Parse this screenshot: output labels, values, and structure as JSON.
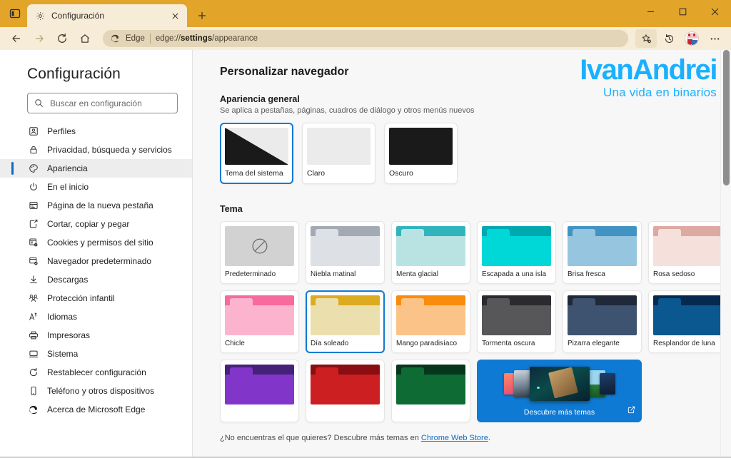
{
  "window": {
    "tab": {
      "title": "Configuración",
      "favicon": "gear-icon",
      "close": "×"
    },
    "new_tab": "+",
    "controls": {
      "minimize": "−",
      "maximize": "□",
      "close": "✕"
    },
    "titlebar_color": "#e2a52a",
    "toolbar_color": "#f7ecd7"
  },
  "toolbar": {
    "back": "←",
    "forward": "→",
    "reload": "⟳",
    "home": "⌂",
    "omnibox": {
      "brand": "Edge",
      "url_prefix": "edge://",
      "url_bold": "settings",
      "url_suffix": "/appearance",
      "full_url": "edge://settings/appearance"
    },
    "favorites": "star-plus-icon",
    "history": "history-icon",
    "profile": "avatar",
    "more": "…"
  },
  "sidebar": {
    "title": "Configuración",
    "search": {
      "placeholder": "Buscar en configuración",
      "value": ""
    },
    "items": [
      {
        "label": "Perfiles",
        "icon": "profile-icon",
        "active": false
      },
      {
        "label": "Privacidad, búsqueda y servicios",
        "icon": "lock-icon",
        "active": false
      },
      {
        "label": "Apariencia",
        "icon": "palette-icon",
        "active": true
      },
      {
        "label": "En el inicio",
        "icon": "power-icon",
        "active": false
      },
      {
        "label": "Página de la nueva pestaña",
        "icon": "newtab-icon",
        "active": false
      },
      {
        "label": "Cortar, copiar y pegar",
        "icon": "clipboard-icon",
        "active": false
      },
      {
        "label": "Cookies y permisos del sitio",
        "icon": "cookies-icon",
        "active": false
      },
      {
        "label": "Navegador predeterminado",
        "icon": "default-browser-icon",
        "active": false
      },
      {
        "label": "Descargas",
        "icon": "download-icon",
        "active": false
      },
      {
        "label": "Protección infantil",
        "icon": "family-icon",
        "active": false
      },
      {
        "label": "Idiomas",
        "icon": "language-icon",
        "active": false
      },
      {
        "label": "Impresoras",
        "icon": "printer-icon",
        "active": false
      },
      {
        "label": "Sistema",
        "icon": "system-icon",
        "active": false
      },
      {
        "label": "Restablecer configuración",
        "icon": "reset-icon",
        "active": false
      },
      {
        "label": "Teléfono y otros dispositivos",
        "icon": "phone-icon",
        "active": false
      },
      {
        "label": "Acerca de Microsoft Edge",
        "icon": "edge-icon",
        "active": false
      }
    ]
  },
  "watermark": {
    "main": "IvanAndrei",
    "sub": "Una vida en binarios",
    "color": "#19b1ff"
  },
  "main": {
    "page_title": "Personalizar navegador",
    "general": {
      "heading": "Apariencia general",
      "subtext": "Se aplica a pestañas, páginas, cuadros de diálogo y otros menús nuevos",
      "options": [
        {
          "label": "Tema del sistema",
          "selected": true,
          "kind": "split",
          "light": "#ebebeb",
          "dark": "#1a1a1a"
        },
        {
          "label": "Claro",
          "selected": false,
          "kind": "solid",
          "light": "#ebebeb",
          "dark": "#ebebeb"
        },
        {
          "label": "Oscuro",
          "selected": false,
          "kind": "solid",
          "light": "#1a1a1a",
          "dark": "#1a1a1a"
        }
      ]
    },
    "theme": {
      "heading": "Tema",
      "items": [
        {
          "name": "Predeterminado",
          "selected": false,
          "default": true,
          "bar": "#d2d2d2",
          "tab": "#d2d2d2",
          "body": "#d2d2d2"
        },
        {
          "name": "Niebla matinal",
          "selected": false,
          "default": false,
          "bar": "#a3aab4",
          "tab": "#dde0e4",
          "body": "#dde0e4"
        },
        {
          "name": "Menta glacial",
          "selected": false,
          "default": false,
          "bar": "#30b5bd",
          "tab": "#b9e3e3",
          "body": "#b9e3e3"
        },
        {
          "name": "Escapada a una isla",
          "selected": false,
          "default": false,
          "bar": "#00a8b0",
          "tab": "#00d8d8",
          "body": "#00d8d8"
        },
        {
          "name": "Brisa fresca",
          "selected": false,
          "default": false,
          "bar": "#4193c4",
          "tab": "#96c5e0",
          "body": "#96c5e0"
        },
        {
          "name": "Rosa sedoso",
          "selected": false,
          "default": false,
          "bar": "#dda9a2",
          "tab": "#f6e0dc",
          "body": "#f6e0dc"
        },
        {
          "name": "Chicle",
          "selected": false,
          "default": false,
          "bar": "#f8699c",
          "tab": "#fcb4ce",
          "body": "#fcb4ce"
        },
        {
          "name": "Día soleado",
          "selected": true,
          "default": false,
          "bar": "#ddab1f",
          "tab": "#ecdfae",
          "body": "#ecdfae"
        },
        {
          "name": "Mango paradisíaco",
          "selected": false,
          "default": false,
          "bar": "#f98c0b",
          "tab": "#fcc388",
          "body": "#fcc388"
        },
        {
          "name": "Tormenta oscura",
          "selected": false,
          "default": false,
          "bar": "#2b2b2f",
          "tab": "#57575a",
          "body": "#57575a"
        },
        {
          "name": "Pizarra elegante",
          "selected": false,
          "default": false,
          "bar": "#20293a",
          "tab": "#3e536f",
          "body": "#3e536f"
        },
        {
          "name": "Resplandor de luna",
          "selected": false,
          "default": false,
          "bar": "#062a4f",
          "tab": "#0b5890",
          "body": "#0b5890"
        }
      ],
      "discover": {
        "label": "Descubre más temas",
        "external_icon": "external-link-icon",
        "background": "#0f7ad4"
      }
    },
    "footnote": {
      "text": "¿No encuentras el que quieres? Descubre más temas en ",
      "link": "Chrome Web Store",
      "suffix": "."
    }
  }
}
